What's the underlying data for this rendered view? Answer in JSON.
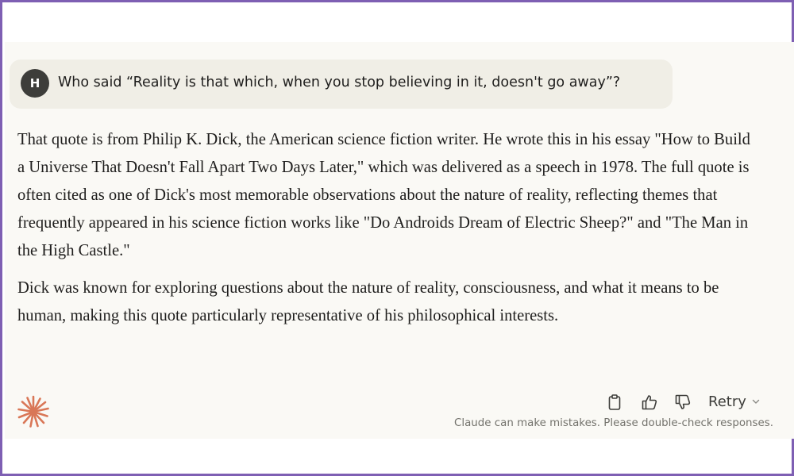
{
  "user_message": {
    "avatar_initial": "H",
    "text": "Who said “Reality is that which, when you stop believing in it, doesn't go away”?"
  },
  "response": {
    "paragraphs": [
      "That quote is from Philip K. Dick, the American science fiction writer. He wrote this in his essay \"How to Build a Universe That Doesn't Fall Apart Two Days Later,\" which was delivered as a speech in 1978. The full quote is often cited as one of Dick's most memorable observations about the nature of reality, reflecting themes that frequently appeared in his science fiction works like \"Do Androids Dream of Electric Sheep?\" and \"The Man in the High Castle.\"",
      "Dick was known for exploring questions about the nature of reality, consciousness, and what it means to be human, making this quote particularly representative of his philosophical interests."
    ]
  },
  "actions": {
    "copy_icon": "clipboard-icon",
    "thumbs_up_icon": "thumbs-up-icon",
    "thumbs_down_icon": "thumbs-down-icon",
    "retry_label": "Retry",
    "retry_chevron_icon": "chevron-down-icon"
  },
  "disclaimer": "Claude can make mistakes. Please double-check responses.",
  "colors": {
    "frame_border": "#7e5fb3",
    "chat_background": "#faf9f5",
    "user_bubble": "#f0eee6",
    "avatar_background": "#3d3d3a",
    "claude_accent": "#d97757",
    "text_primary": "#1f1e1d",
    "text_muted": "#73726c"
  }
}
